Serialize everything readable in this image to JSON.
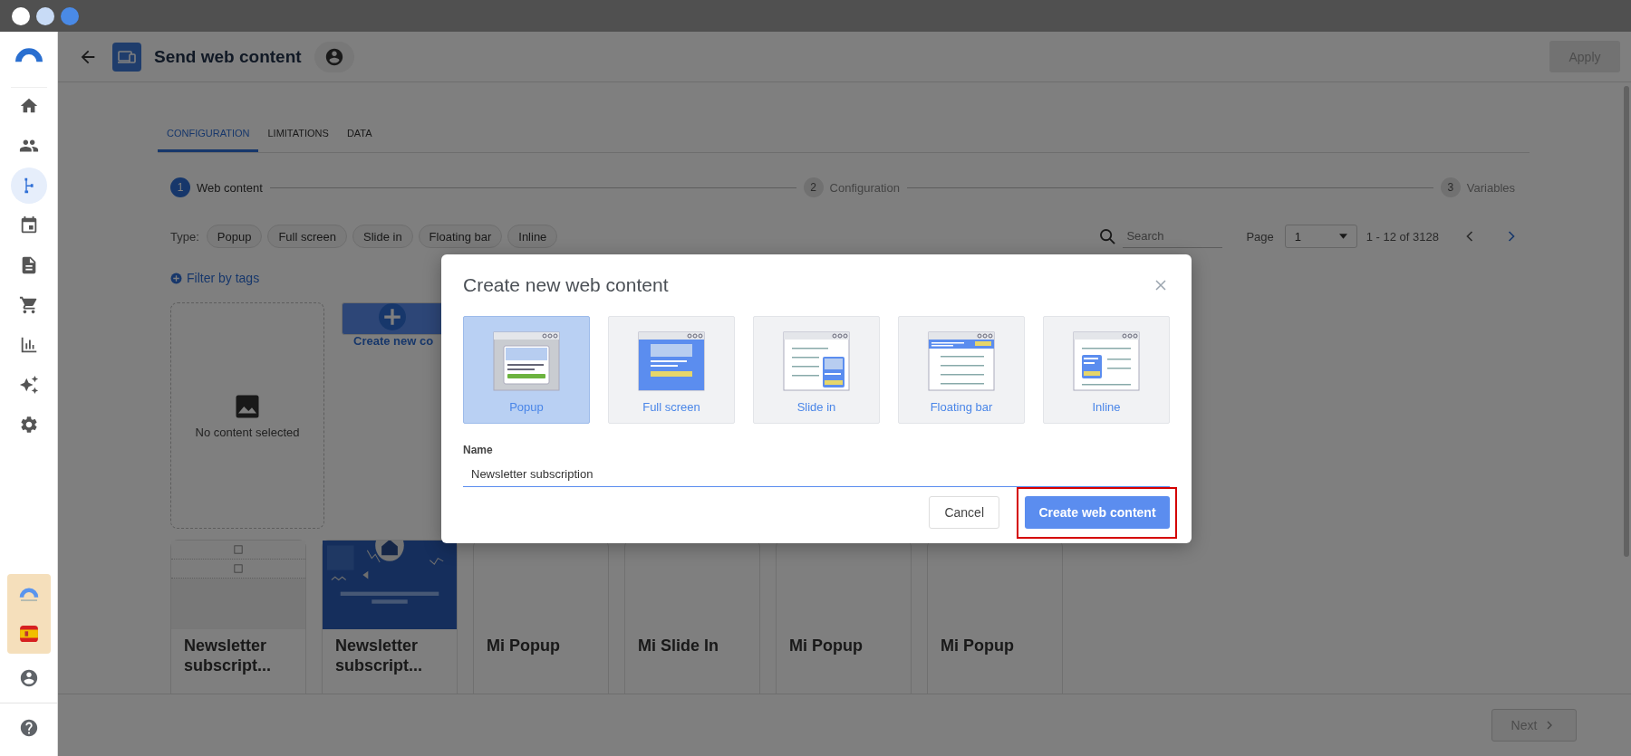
{
  "sidebar": {
    "items": [
      {
        "kind": "home",
        "selected": false
      },
      {
        "kind": "people",
        "selected": false
      },
      {
        "kind": "flow",
        "selected": true
      },
      {
        "kind": "calendar",
        "selected": false
      },
      {
        "kind": "document",
        "selected": false
      },
      {
        "kind": "cart",
        "selected": false
      },
      {
        "kind": "chart",
        "selected": false
      },
      {
        "kind": "sparkles",
        "selected": false
      },
      {
        "kind": "settings",
        "selected": false
      }
    ]
  },
  "header": {
    "title": "Send web content",
    "apply_button": "Apply",
    "apply_disabled": true
  },
  "tabs": [
    {
      "label": "CONFIGURATION",
      "selected": true
    },
    {
      "label": "LIMITATIONS",
      "selected": false
    },
    {
      "label": "DATA",
      "selected": false
    }
  ],
  "stepper": [
    {
      "number": "1",
      "label": "Web content",
      "selected": true
    },
    {
      "number": "2",
      "label": "Configuration",
      "selected": false
    },
    {
      "number": "3",
      "label": "Variables",
      "selected": false
    }
  ],
  "filters": {
    "type_label": "Type:",
    "types": [
      "Popup",
      "Full screen",
      "Slide in",
      "Floating bar",
      "Inline"
    ],
    "search": {
      "placeholder": "Search"
    },
    "page_label": "Page",
    "page_value": "1",
    "range": "1 - 12 of 3128",
    "filter_by_tags": "Filter by tags"
  },
  "top_cards": [
    {
      "kind": "empty",
      "label": "No content selected"
    },
    {
      "kind": "create",
      "label": "Create new co"
    }
  ],
  "content_cards": [
    {
      "title": "Newsletter subscript...",
      "kind": "table"
    },
    {
      "title": "Newsletter subscript...",
      "kind": "picture"
    },
    {
      "title": "Mi Popup",
      "kind": "blank"
    },
    {
      "title": "Mi Slide In",
      "kind": "blank"
    },
    {
      "title": "Mi Popup",
      "kind": "blank"
    },
    {
      "title": "Mi Popup",
      "kind": "blank"
    }
  ],
  "next_button": {
    "label": "Next",
    "disabled": true
  },
  "dialog": {
    "title": "Create new web content",
    "types": [
      {
        "kind": "popup",
        "label": "Popup",
        "selected": true
      },
      {
        "kind": "fullscreen",
        "label": "Full screen",
        "selected": false
      },
      {
        "kind": "slidein",
        "label": "Slide in",
        "selected": false
      },
      {
        "kind": "floatingbar",
        "label": "Floating bar",
        "selected": false
      },
      {
        "kind": "inline",
        "label": "Inline",
        "selected": false
      }
    ],
    "name_label": "Name",
    "name_value": "Newsletter subscription",
    "cancel": "Cancel",
    "confirm": "Create web content",
    "confirm_highlighted": true
  }
}
